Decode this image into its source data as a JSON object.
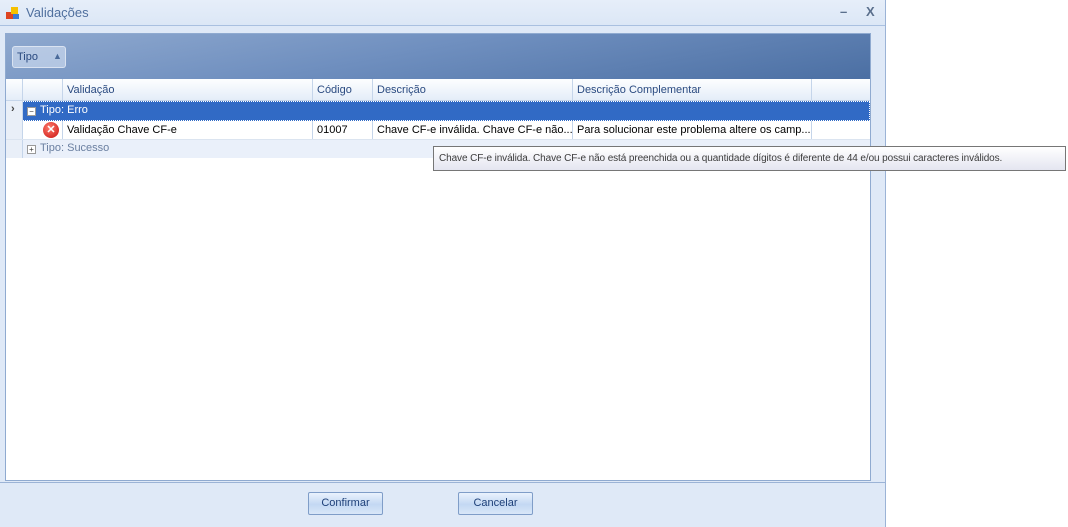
{
  "window": {
    "title": "Validações",
    "minimize": "–",
    "close": "X"
  },
  "group_panel": {
    "group_by": "Tipo",
    "sort": "▲"
  },
  "columns": [
    "Validação",
    "Código",
    "Descrição",
    "Descrição Complementar"
  ],
  "groups": [
    {
      "label": "Tipo: Erro",
      "toggle": "−",
      "rows": [
        {
          "icon": "error-icon",
          "validacao": "Validação Chave CF-e",
          "codigo": "01007",
          "descricao": "Chave CF-e inválida. Chave CF-e não...",
          "complementar": "Para solucionar este problema altere os camp..."
        }
      ]
    },
    {
      "label": "Tipo: Sucesso",
      "toggle": "+"
    }
  ],
  "row_indicator": "›",
  "tooltip": "Chave CF-e inválida. Chave CF-e não está preenchida ou a quantidade dígitos é diferente de 44 e/ou possui caracteres inválidos.",
  "buttons": {
    "confirm": "Confirmar",
    "cancel": "Cancelar"
  }
}
